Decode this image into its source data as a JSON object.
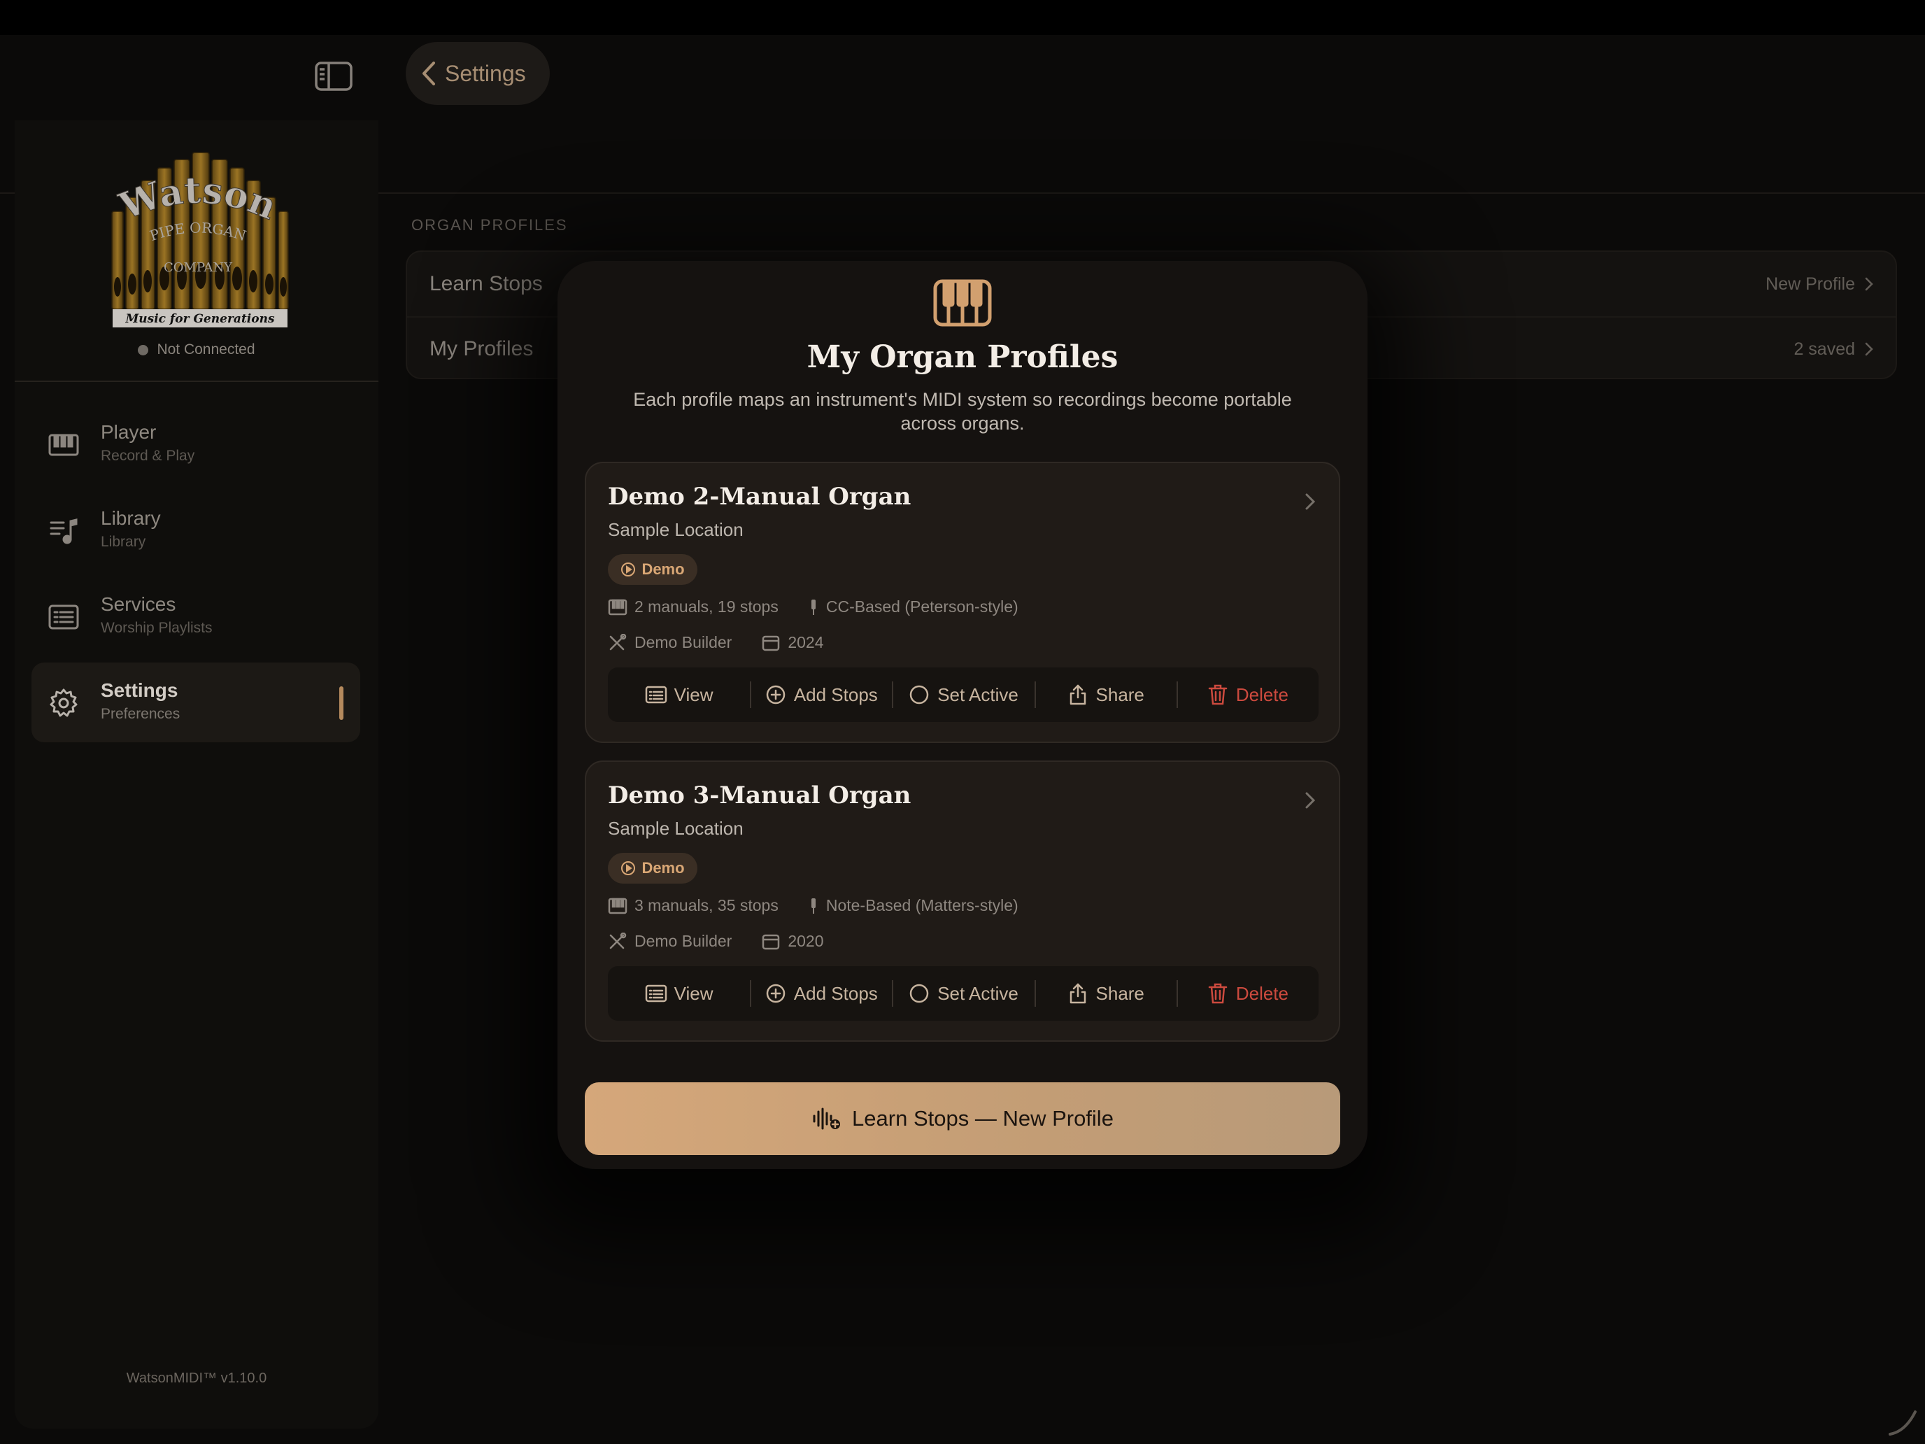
{
  "sidebar": {
    "logo": {
      "line1": "Watson",
      "line2": "PIPE ORGAN",
      "line3": "COMPANY",
      "tagline": "Music for Generations"
    },
    "connection_status": "Not Connected",
    "nav": [
      {
        "title": "Player",
        "subtitle": "Record & Play",
        "icon": "piano-keys-icon"
      },
      {
        "title": "Library",
        "subtitle": "Library",
        "icon": "music-list-icon"
      },
      {
        "title": "Services",
        "subtitle": "Worship Playlists",
        "icon": "list-icon"
      },
      {
        "title": "Settings",
        "subtitle": "Preferences",
        "icon": "gear-icon",
        "active": true
      }
    ],
    "version": "WatsonMIDI™ v1.10.0"
  },
  "header": {
    "back_label": "Settings"
  },
  "section": {
    "label": "ORGAN PROFILES",
    "rows": [
      {
        "label": "Learn Stops",
        "value": "New Profile"
      },
      {
        "label": "My Profiles",
        "value": "2 saved"
      }
    ]
  },
  "modal": {
    "title": "My Organ Profiles",
    "subtitle": "Each profile maps an instrument's MIDI system so recordings become portable across organs.",
    "profiles": [
      {
        "name": "Demo 2-Manual Organ",
        "location": "Sample Location",
        "badge": "Demo",
        "manuals": "2 manuals, 19 stops",
        "protocol": "CC-Based (Peterson-style)",
        "builder": "Demo Builder",
        "year": "2024"
      },
      {
        "name": "Demo 3-Manual Organ",
        "location": "Sample Location",
        "badge": "Demo",
        "manuals": "3 manuals, 35 stops",
        "protocol": "Note-Based (Matters-style)",
        "builder": "Demo Builder",
        "year": "2020"
      }
    ],
    "actions": {
      "view": "View",
      "add_stops": "Add Stops",
      "set_active": "Set Active",
      "share": "Share",
      "delete": "Delete"
    },
    "primary_button": "Learn Stops — New Profile"
  },
  "colors": {
    "accent": "#d5a77a",
    "danger": "#cc4a3e",
    "background": "#0b0a09"
  }
}
